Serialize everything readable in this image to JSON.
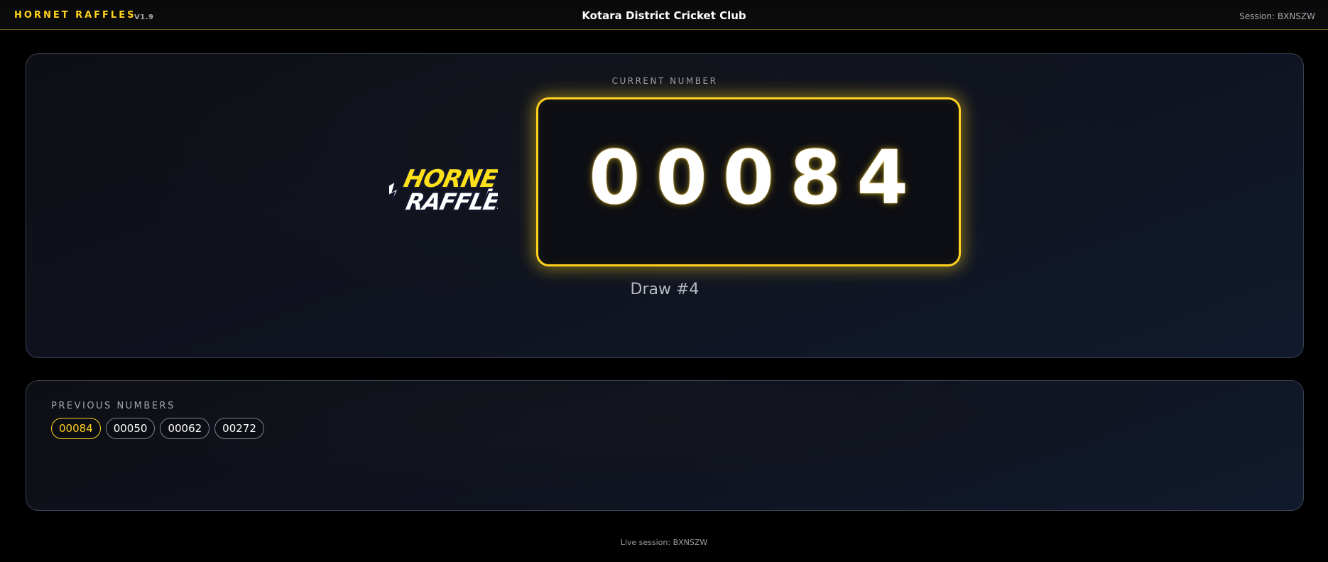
{
  "header": {
    "brand": "HORNET RAFFLES",
    "version": "V1.9",
    "club_name": "Kotara District Cricket Club",
    "session": "Session: BXNSZW"
  },
  "current": {
    "caption": "CURRENT NUMBER",
    "number": "00084",
    "draw": "Draw #4",
    "logo": {
      "name": "hornet-raffles-logo",
      "line1": "HORNET",
      "line2": "RAFFLES"
    }
  },
  "previous": {
    "caption": "PREVIOUS NUMBERS",
    "numbers": [
      "00084",
      "00050",
      "00062",
      "00272"
    ],
    "active_index": 0
  },
  "footer": {
    "text": "Live session: BXNSZW"
  },
  "colors": {
    "accent": "#ffd21f",
    "background": "#000000",
    "panel_border": "#3a4052"
  }
}
